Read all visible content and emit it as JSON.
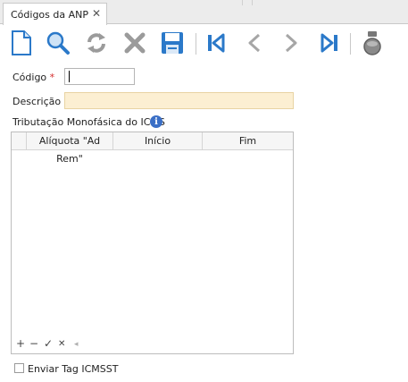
{
  "tab": {
    "title": "Códigos da ANP",
    "close_glyph": "✕"
  },
  "toolbar": {
    "buttons": [
      {
        "name": "new-document-icon"
      },
      {
        "name": "search-icon"
      },
      {
        "name": "refresh-icon"
      },
      {
        "name": "delete-icon"
      },
      {
        "name": "save-icon"
      },
      {
        "name": "first-record-icon"
      },
      {
        "name": "previous-record-icon"
      },
      {
        "name": "next-record-icon"
      },
      {
        "name": "last-record-icon"
      },
      {
        "name": "stamp-icon"
      }
    ]
  },
  "form": {
    "codigo": {
      "label": "Código",
      "required_mark": "*",
      "value": ""
    },
    "descricao": {
      "label": "Descrição",
      "required_mark": "*",
      "value": ""
    },
    "tributacao": {
      "label": "Tributação Monofásica do ICMS",
      "info_glyph": "i"
    }
  },
  "grid": {
    "columns": [
      "Alíquota \"Ad Rem\"",
      "Início",
      "Fim"
    ],
    "rows": [],
    "nav": {
      "add": "+",
      "remove": "−",
      "confirm": "✓",
      "cancel": "✕",
      "left": "◂"
    }
  },
  "enviar_tag": {
    "label": "Enviar Tag ICMSST",
    "checked": false
  },
  "colors": {
    "required_bg": "#fcefd2",
    "required_mark": "#d42b2b",
    "info_icon": "#3b6fc6",
    "toolbar_blue": "#2b79c9"
  }
}
